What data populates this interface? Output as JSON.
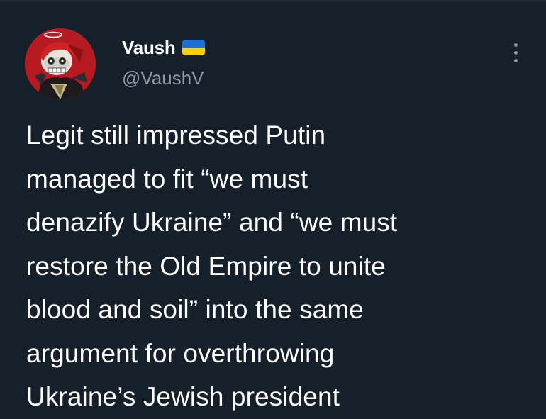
{
  "tweet": {
    "author": {
      "display_name": "Vaush",
      "handle": "@VaushV",
      "flag": {
        "icon": "ukraine-flag-icon",
        "top_color": "#1d6fd3",
        "bottom_color": "#f5d20b"
      },
      "avatar": "cartoon-avatar-image"
    },
    "more_icon": "more-vertical-icon",
    "text": "Legit still impressed Putin\nmanaged to fit “we must\ndenazify Ukraine” and “we must\nrestore the Old Empire to unite\nblood and soil” into the same\nargument for overthrowing\nUkraine’s Jewish president"
  },
  "colors": {
    "background": "#15202b",
    "primary_text": "#ffffff",
    "secondary_text": "#8b98a5"
  }
}
